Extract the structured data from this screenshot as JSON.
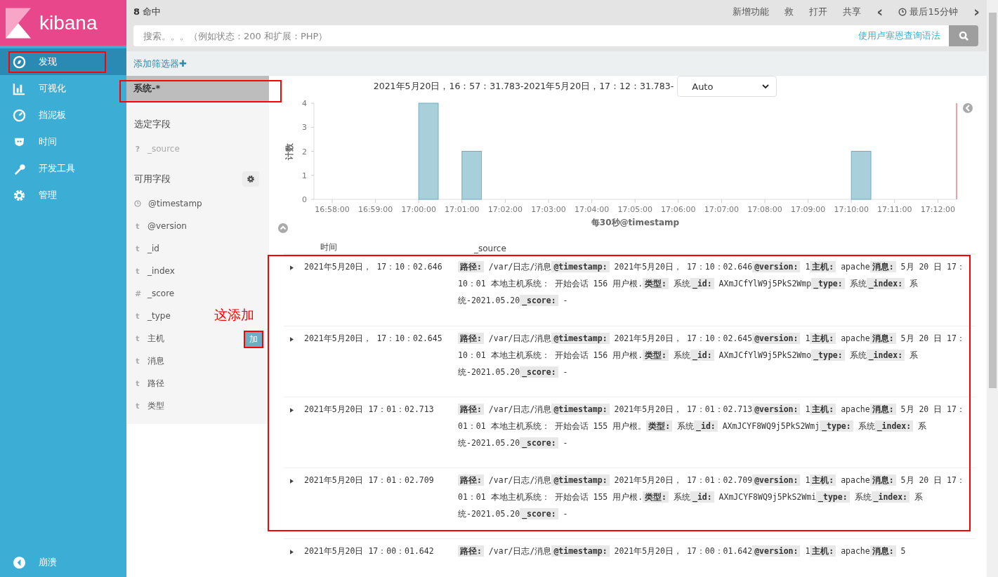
{
  "logo": {
    "text": "kibana"
  },
  "nav": [
    {
      "label": "发现",
      "selected": true,
      "annotated": true
    },
    {
      "label": "可视化",
      "selected": false,
      "annotated": false
    },
    {
      "label": "挡泥板",
      "selected": false,
      "annotated": false
    },
    {
      "label": "时间",
      "selected": false,
      "annotated": false
    },
    {
      "label": "开发工具",
      "selected": false,
      "annotated": false
    },
    {
      "label": "管理",
      "selected": false,
      "annotated": false
    }
  ],
  "collapse": {
    "label": "崩溃"
  },
  "top_bar": {
    "hits_count": "8",
    "hits_label": "命中",
    "menu": [
      "新增功能",
      "救",
      "打开",
      "共享"
    ],
    "prev": "‹",
    "time_range": "最后15分钟",
    "next": "›"
  },
  "search": {
    "placeholder": "搜索。。。（例如状态：200 和扩展：PHP）",
    "syntax_link": "使用卢塞恩查询语法"
  },
  "filter_bar": {
    "add_filter": "添加筛选器",
    "plus": "✚"
  },
  "index_pattern": {
    "name": "系统-*",
    "annotated": true
  },
  "selected_fields": {
    "title": "选定字段",
    "fields": [
      {
        "type": "?",
        "name": "_source"
      }
    ]
  },
  "available_fields": {
    "title": "可用字段",
    "fields": [
      {
        "kind": "date",
        "name": "@timestamp",
        "add_button": false
      },
      {
        "kind": "text",
        "type": "t",
        "name": "@version",
        "add_button": false
      },
      {
        "kind": "text",
        "type": "t",
        "name": "_id",
        "add_button": false
      },
      {
        "kind": "text",
        "type": "t",
        "name": "_index",
        "add_button": false
      },
      {
        "kind": "text",
        "type": "#",
        "name": "_score",
        "add_button": false
      },
      {
        "kind": "text",
        "type": "t",
        "name": "_type",
        "add_button": false
      },
      {
        "kind": "text",
        "type": "t",
        "name": "主机",
        "add_button": true,
        "add_label": "加"
      },
      {
        "kind": "text",
        "type": "t",
        "name": "消息",
        "add_button": false
      },
      {
        "kind": "text",
        "type": "t",
        "name": "路径",
        "add_button": false
      },
      {
        "kind": "text",
        "type": "t",
        "name": "类型",
        "add_button": false
      }
    ]
  },
  "annotation_note": "这添加",
  "histogram": {
    "range": "2021年5月20日，16：57：31.783-2021年5月20日，17：12：31.783-",
    "interval": "Auto",
    "chart_data": {
      "type": "bar",
      "xlabel": "每30秒@timestamp",
      "ylabel": "计数",
      "ylim": [
        0,
        4
      ],
      "yticks": [
        0,
        1,
        2,
        3,
        4
      ],
      "categories": [
        null,
        "16:58:00",
        null,
        "16:59:00",
        null,
        "17:00:00",
        null,
        "17:01:00",
        null,
        "17:02:00",
        null,
        "17:03:00",
        null,
        "17:04:00",
        null,
        "17:05:00",
        null,
        "17:06:00",
        null,
        "17:07:00",
        null,
        "17:08:00",
        null,
        "17:09:00",
        null,
        "17:10:00",
        null,
        "17:11:00",
        null,
        "17:12:00",
        null
      ],
      "values": [
        0,
        0,
        0,
        0,
        0,
        4,
        0,
        2,
        0,
        0,
        0,
        0,
        0,
        0,
        0,
        0,
        0,
        0,
        0,
        0,
        0,
        0,
        0,
        0,
        0,
        2,
        0,
        0,
        0,
        0,
        0
      ]
    }
  },
  "table": {
    "columns": [
      "时间",
      "_source"
    ],
    "rows": [
      {
        "time": "2021年5月20日， 17：10：02.646",
        "source": [
          {
            "key": "路径:",
            "value": "/var/日志/消息"
          },
          {
            "key": "@timestamp:",
            "value": "2021年5月20日， 17：10：02.646"
          },
          {
            "key": "@version:",
            "value": "1"
          },
          {
            "key": "主机:",
            "value": "apache"
          },
          {
            "key": "消息:",
            "value": "5月 20 日 17：10：01 本地主机系统： 开始会话 156 用户根."
          },
          {
            "key": "类型:",
            "value": "系统"
          },
          {
            "key": "_id:",
            "value": "AXmJCfYlW9j5PkS2Wmp"
          },
          {
            "key": "_type:",
            "value": "系统"
          },
          {
            "key": "_index:",
            "value": "系统-2021.05.20"
          },
          {
            "key": "_score:",
            "value": "-"
          }
        ]
      },
      {
        "time": "2021年5月20日， 17：10：02.645",
        "source": [
          {
            "key": "路径:",
            "value": "/var/日志/消息"
          },
          {
            "key": "@timestamp:",
            "value": "2021年5月20日， 17：10：02.645"
          },
          {
            "key": "@version:",
            "value": "1"
          },
          {
            "key": "主机:",
            "value": "apache"
          },
          {
            "key": "消息:",
            "value": "5月 20 日 17：10：01 本地主机系统： 开始会话 156 用户根."
          },
          {
            "key": "类型:",
            "value": "系统"
          },
          {
            "key": "_id:",
            "value": "AXmJCfYlW9j5PkS2Wmo"
          },
          {
            "key": "_type:",
            "value": "系统"
          },
          {
            "key": "_index:",
            "value": "系统-2021.05.20"
          },
          {
            "key": "_score:",
            "value": "-"
          }
        ]
      },
      {
        "time": "2021年5月20日 17：01：02.713",
        "source": [
          {
            "key": "路径:",
            "value": "/var/日志/消息"
          },
          {
            "key": "@timestamp:",
            "value": "2021年5月20日， 17：01：02.713"
          },
          {
            "key": "@version:",
            "value": "1"
          },
          {
            "key": "主机:",
            "value": "apache"
          },
          {
            "key": "消息:",
            "value": "5月 20 日 17：01：01 本地主机系统： 开始会话 155 用户根。"
          },
          {
            "key": "类型:",
            "value": "系统"
          },
          {
            "key": "_id:",
            "value": "AXmJCYF8WQ9j5PkS2Wmj"
          },
          {
            "key": "_type:",
            "value": "系统"
          },
          {
            "key": "_index:",
            "value": "系统-2021.05.20"
          },
          {
            "key": "_score:",
            "value": "-"
          }
        ]
      },
      {
        "time": "2021年5月20日 17：01：02.709",
        "source": [
          {
            "key": "路径:",
            "value": "/var/日志/消息"
          },
          {
            "key": "@timestamp:",
            "value": "2021年5月20日， 17：01：02.709"
          },
          {
            "key": "@version:",
            "value": "1"
          },
          {
            "key": "主机:",
            "value": "apache"
          },
          {
            "key": "消息:",
            "value": "5月 20 日 17：01：01 本地主机系统： 开始会话 155 用户根."
          },
          {
            "key": "类型:",
            "value": "系统"
          },
          {
            "key": "_id:",
            "value": "AXmJCYF8WQ9j5PkS2Wmi"
          },
          {
            "key": "_type:",
            "value": "系统"
          },
          {
            "key": "_index:",
            "value": "系统-2021.05.20"
          },
          {
            "key": "_score:",
            "value": "-"
          }
        ]
      },
      {
        "time": "2021年5月20日 17：00：01.642",
        "source": [
          {
            "key": "路径:",
            "value": "/var/日志/消息"
          },
          {
            "key": "@timestamp:",
            "value": "2021年5月20日， 17：00：01.642"
          },
          {
            "key": "@version:",
            "value": "1"
          },
          {
            "key": "主机:",
            "value": "apache"
          },
          {
            "key": "消息:",
            "value": "5"
          }
        ]
      }
    ]
  }
}
